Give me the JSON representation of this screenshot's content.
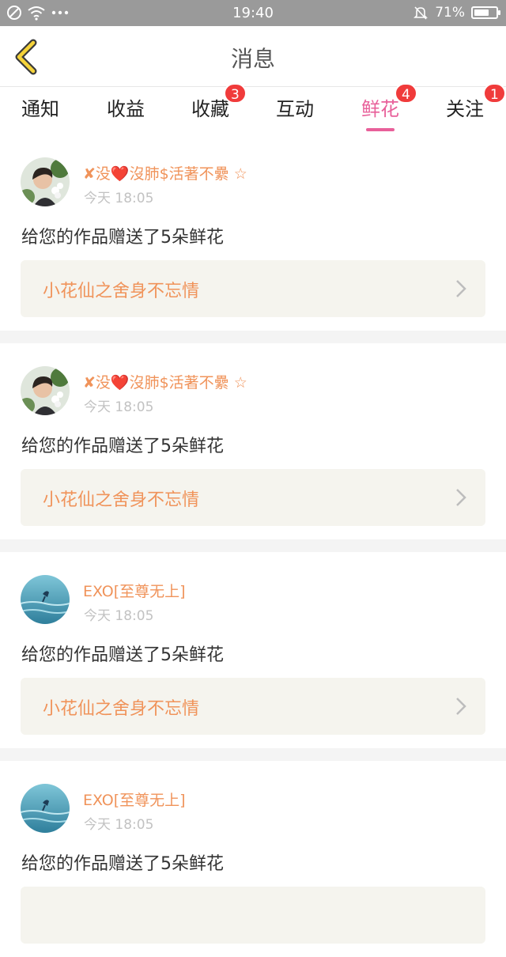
{
  "status_bar": {
    "time": "19:40",
    "battery_text": "71%",
    "battery_level": 0.71
  },
  "header": {
    "title": "消息"
  },
  "tabs": [
    {
      "label": "通知",
      "badge": ""
    },
    {
      "label": "收益",
      "badge": ""
    },
    {
      "label": "收藏",
      "badge": "3"
    },
    {
      "label": "互动",
      "badge": ""
    },
    {
      "label": "鲜花",
      "badge": "4",
      "active": true
    },
    {
      "label": "关注",
      "badge": "1"
    }
  ],
  "messages": [
    {
      "sender": "✘没❤️沒肺$活著不纍 ☆",
      "time": "今天 18:05",
      "text": "给您的作品赠送了5朵鲜花",
      "work_title": "小花仙之舍身不忘情",
      "avatar": "woman-with-flowers"
    },
    {
      "sender": "✘没❤️沒肺$活著不纍 ☆",
      "time": "今天 18:05",
      "text": "给您的作品赠送了5朵鲜花",
      "work_title": "小花仙之舍身不忘情",
      "avatar": "woman-with-flowers"
    },
    {
      "sender": "EXO[至尊无上]",
      "time": "今天 18:05",
      "text": "给您的作品赠送了5朵鲜花",
      "work_title": "小花仙之舍身不忘情",
      "avatar": "ocean-swimmer"
    },
    {
      "sender": "EXO[至尊无上]",
      "time": "今天 18:05",
      "text": "给您的作品赠送了5朵鲜花",
      "work_title": "",
      "avatar": "ocean-swimmer"
    }
  ],
  "colors": {
    "accent_pink": "#e8609a",
    "sender_orange": "#f0935a",
    "badge_red": "#f03b3b",
    "back_arrow_yellow": "#f5d33a"
  }
}
